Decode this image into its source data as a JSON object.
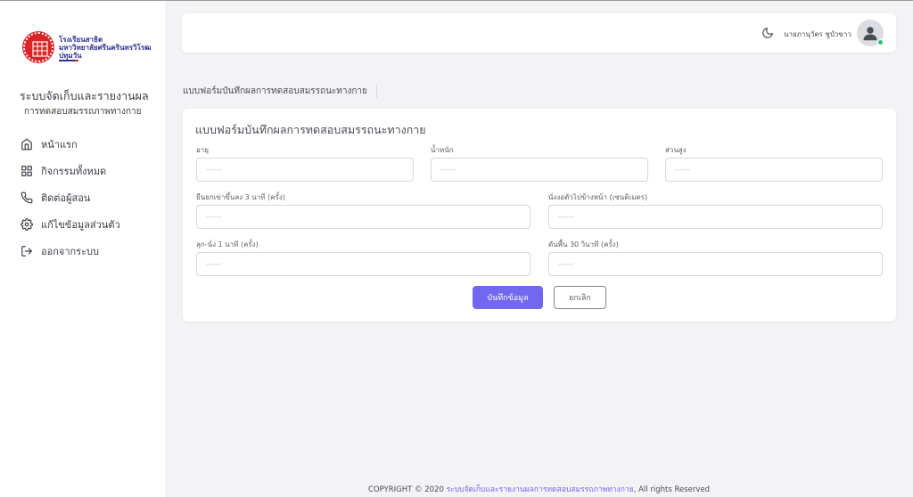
{
  "sidebar": {
    "logo_lines": [
      "โรงเรียนสาธิต",
      "มหาวิทยาลัยศรีนครินทรวิโรฒ",
      "ปทุมวัน"
    ],
    "system_title": "ระบบจัดเก็บและรายงานผล",
    "system_subtitle": "การทดสอบสมรรถภาพทางกาย",
    "menu": [
      {
        "label": "หน้าแรก",
        "icon": "home-icon"
      },
      {
        "label": "กิจกรรมทั้งหมด",
        "icon": "grid-icon"
      },
      {
        "label": "ติดต่อผู้สอน",
        "icon": "phone-icon"
      },
      {
        "label": "แก้ไขข้อมูลส่วนตัว",
        "icon": "settings-icon"
      },
      {
        "label": "ออกจากระบบ",
        "icon": "logout-icon"
      }
    ]
  },
  "header": {
    "user_name": "นายภานุวัตร ชูบัวขาว",
    "online_color": "#28c76f"
  },
  "breadcrumb": "แบบฟอร์มบันทึกผลการทดสอบสมรรถนะทางกาย",
  "form": {
    "title": "แบบฟอร์มบันทึกผลการทดสอบสมรรถนะทางกาย",
    "fields": {
      "age": {
        "label": "อายุ",
        "placeholder": "------",
        "value": ""
      },
      "weight": {
        "label": "น้ำหนัก",
        "placeholder": "------",
        "value": ""
      },
      "height": {
        "label": "ส่วนสูง",
        "placeholder": "------",
        "value": ""
      },
      "step_up": {
        "label": "ยืนยกเข่าขึ้นลง 3 นาที (ครั้ง)",
        "placeholder": "------",
        "value": ""
      },
      "sit_reach": {
        "label": "นั่งงอตัวไปข้างหน้า (เซนติเมตร)",
        "placeholder": "------",
        "value": ""
      },
      "sit_stand": {
        "label": "ลุก-นั่ง 1 นาที (ครั้ง)",
        "placeholder": "------",
        "value": ""
      },
      "push_up": {
        "label": "ดันพื้น 30 วินาที (ครั้ง)",
        "placeholder": "------",
        "value": ""
      }
    },
    "save_label": "บันทึกข้อมูล",
    "cancel_label": "ยกเลิก"
  },
  "footer": {
    "prefix": "COPYRIGHT © 2020 ",
    "link": "ระบบจัดเก็บและรายงานผลการทดสอบสมรรถภาพทางกาย",
    "suffix": ", All rights Reserved"
  },
  "colors": {
    "accent": "#7367f0",
    "brand_red": "#d92428",
    "brand_blue": "#2e3192"
  }
}
